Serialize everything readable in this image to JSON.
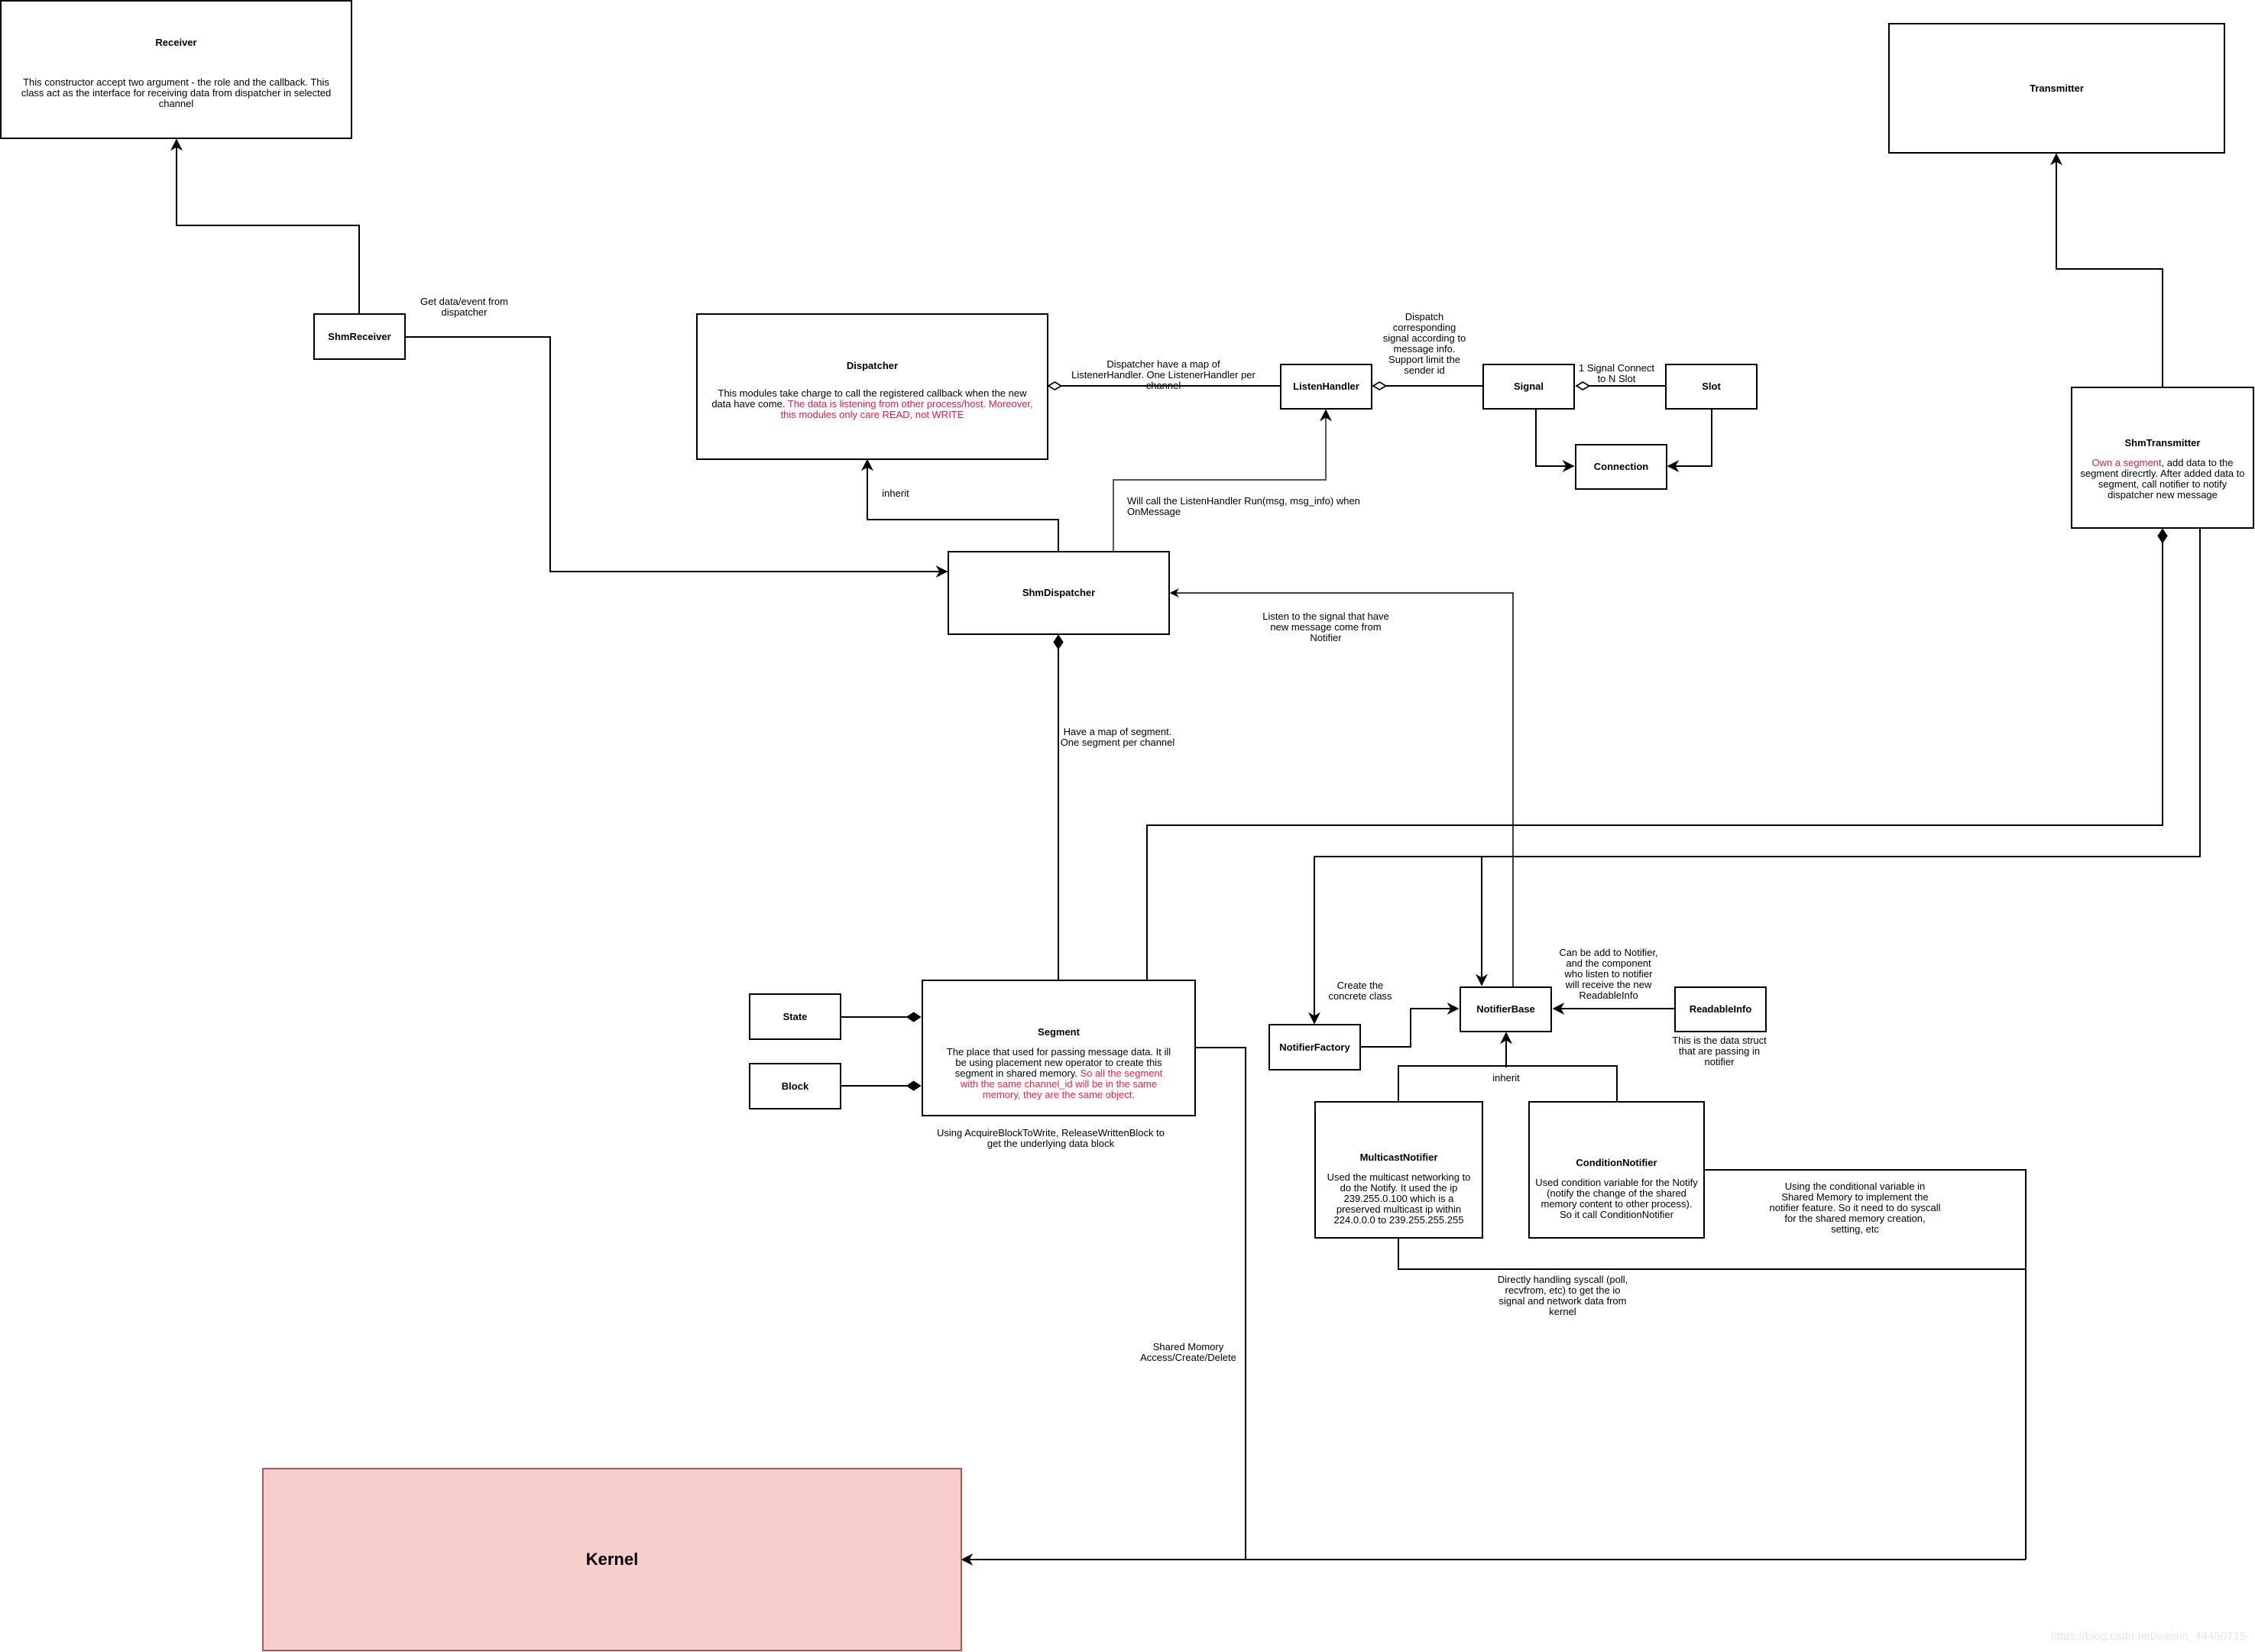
{
  "nodes": {
    "receiver": {
      "title": "Receiver",
      "desc": "This constructor accept two argument - the role and the callback. This class act as the interface for receiving data from dispatcher in selected channel"
    },
    "shm_receiver": {
      "title": "ShmReceiver"
    },
    "dispatcher": {
      "title": "Dispatcher",
      "desc_black": "This modules take charge to call the registered callback when the new data have come. ",
      "desc_red": "The data is listening from other process/host. Moreover, this modules only care READ, not WRITE"
    },
    "listen_handler": {
      "title": "ListenHandler"
    },
    "signal": {
      "title": "Signal"
    },
    "slot": {
      "title": "Slot"
    },
    "connection": {
      "title": "Connection"
    },
    "transmitter": {
      "title": "Transmitter"
    },
    "shm_transmitter": {
      "title": "ShmTransmitter",
      "desc_red": "Own a segment",
      "desc_black": ", add data to the segment direcrtly. After added data to segment, call notifier to notify dispatcher new message"
    },
    "shm_dispatcher": {
      "title": "ShmDispatcher"
    },
    "segment": {
      "title": "Segment",
      "desc_black": "The place that used for passing message data. It ill be using placement new operator to create this segment in shared memory. ",
      "desc_red": "So all the segment with the same channel_id will be in the same memory, they are the same object."
    },
    "state": {
      "title": "State"
    },
    "block": {
      "title": "Block"
    },
    "notifier_factory": {
      "title": "NotifierFactory"
    },
    "notifier_base": {
      "title": "NotifierBase"
    },
    "readable_info": {
      "title": "ReadableInfo"
    },
    "multicast_notifier": {
      "title": "MulticastNotifier",
      "desc": "Used the multicast networking to do the Notify. It used the ip 239.255.0.100 which is a preserved multicast ip within 224.0.0.0 to 239.255.255.255"
    },
    "condition_notifier": {
      "title": "ConditionNotifier",
      "desc": "Used condition variable for the Notify (notify the change of the shared memory content to other process). So it call ConditionNotifier"
    },
    "kernel": {
      "title": "Kernel"
    }
  },
  "edge_labels": {
    "get_data": "Get data/event from dispatcher",
    "dispatcher_map": "Dispatcher have a map of ListenerHandler. One ListenerHandler per channel",
    "dispatch_signal": "Dispatch corresponding signal according to message info. Support limit the sender id",
    "signal_slot": "1 Signal Connect to N Slot",
    "inherit_dispatcher": "inherit",
    "will_call": "Will call the ListenHandler Run(msg, msg_info) when OnMessage",
    "listen_signal": "Listen to the signal that have new message come from Notifier",
    "map_segment": "Have a map of segment. One segment per channel",
    "create_concrete": "Create the concrete class",
    "readable_add": "Can be add to Notifier, and the component who listen to notifier will receive the new ReadableInfo",
    "readable_struct": "This is the data struct that are passing in notifier",
    "inherit_notifier": "inherit",
    "acquire_block": "Using AcquireBlockToWrite, ReleaseWrittenBlock to get the underlying data block",
    "cond_var_shm": "Using the conditional variable in Shared Memory to implement the notifier feature. So it need to do syscall for the shared memory creation, setting, etc",
    "syscall": "Directly handling syscall (poll, recvfrom, etc) to get the io signal and network data from kernel",
    "shm_access": "Shared Momory Access/Create/Delete"
  },
  "watermark": "https://blog.csdn.net/weixin_44450715"
}
